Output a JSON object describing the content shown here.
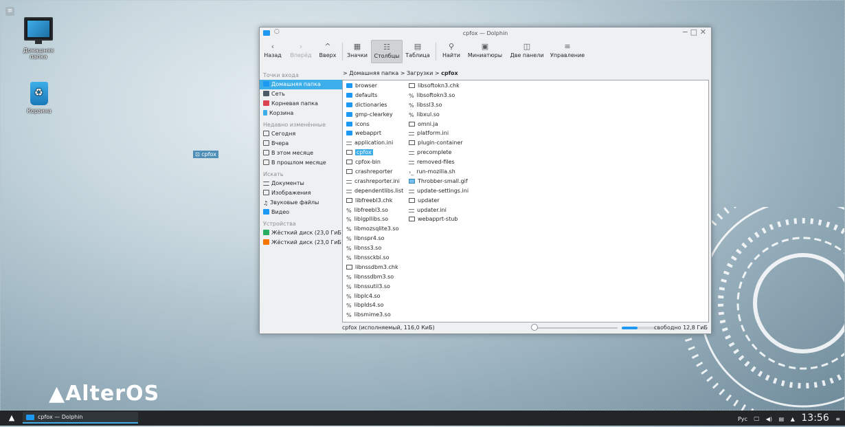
{
  "desktop": {
    "icons": [
      {
        "label": "Домашняя папка",
        "icon": "computer-icon"
      },
      {
        "label": "Корзина",
        "icon": "trash-icon"
      }
    ],
    "drag_label": "cpfox",
    "logo": "AlterOS"
  },
  "window": {
    "title": "cpfox — Dolphin",
    "toolbar": {
      "back": "Назад",
      "forward": "Вперёд",
      "up": "Вверх",
      "icons": "Значки",
      "columns": "Столбцы",
      "table": "Таблица",
      "find": "Найти",
      "thumbnails": "Миниатюры",
      "split": "Две панели",
      "manage": "Управление"
    },
    "places": {
      "entry_head": "Точки входа",
      "entries": [
        "Домашняя папка",
        "Сеть",
        "Корневая папка",
        "Корзина"
      ],
      "recent_head": "Недавно изменённые",
      "recent": [
        "Сегодня",
        "Вчера",
        "В этом месяце",
        "В прошлом месяце"
      ],
      "search_head": "Искать",
      "search": [
        "Документы",
        "Изображения",
        "Звуковые файлы",
        "Видео"
      ],
      "devices_head": "Устройства",
      "devices": [
        "Жёсткий диск (23,0 ГиБ)",
        "Жёсткий диск (23,0 ГиБ)"
      ]
    },
    "breadcrumb": {
      "home": "Домашняя папка",
      "downloads": "Загрузки",
      "current": "cpfox"
    },
    "files_col1": [
      "browser",
      "defaults",
      "dictionaries",
      "gmp-clearkey",
      "icons",
      "webapprt",
      "application.ini",
      "cpfox",
      "cpfox-bin",
      "crashreporter",
      "crashreporter.ini",
      "dependentlibs.list",
      "libfreebl3.chk",
      "libfreebl3.so",
      "liblgpllibs.so",
      "libmozsqlite3.so",
      "libnspr4.so",
      "libnss3.so",
      "libnssckbi.so",
      "libnssdbm3.chk",
      "libnssdbm3.so",
      "libnssutil3.so",
      "libplc4.so",
      "libplds4.so",
      "libsmime3.so"
    ],
    "files_col2": [
      "libsoftokn3.chk",
      "libsoftokn3.so",
      "libssl3.so",
      "libxul.so",
      "omni.ja",
      "platform.ini",
      "plugin-container",
      "precomplete",
      "removed-files",
      "run-mozilla.sh",
      "Throbber-small.gif",
      "update-settings.ini",
      "updater",
      "updater.ini",
      "webapprt-stub"
    ],
    "status": "cpfox (исполняемый, 116,0 КиБ)",
    "free_space": "свободно 12,8 ГиБ",
    "disk_used_fraction": 0.45
  },
  "taskbar": {
    "task": "cpfox — Dolphin",
    "layout": "Рус",
    "clock": "13:56"
  }
}
